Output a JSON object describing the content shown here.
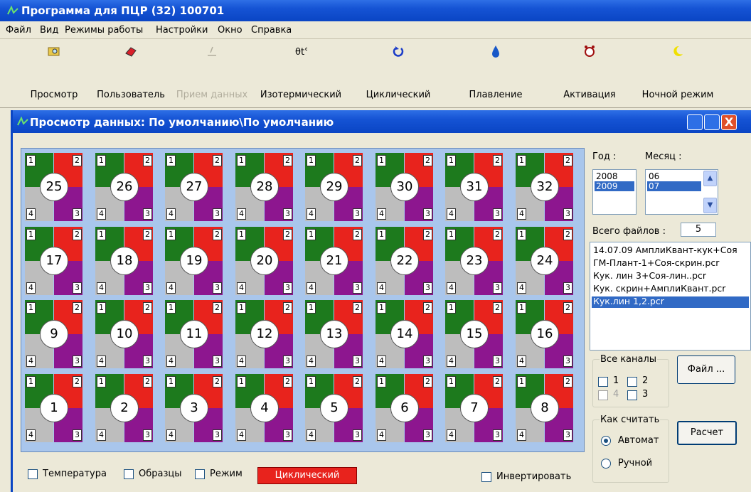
{
  "app": {
    "title": "Программа для ПЦР (32) 100701"
  },
  "menu": [
    "Файл",
    "Вид",
    "Режимы работы",
    "Настройки",
    "Окно",
    "Справка"
  ],
  "toolbar": [
    {
      "label": "Просмотр",
      "icon": "folder-search-icon",
      "enabled": true
    },
    {
      "label": "Пользователь",
      "icon": "eraser-icon",
      "enabled": true
    },
    {
      "label": "Прием данных",
      "icon": "receive-data-icon",
      "enabled": false
    },
    {
      "label": "Изотермический",
      "icon": "thermometer-icon",
      "enabled": true
    },
    {
      "label": "Циклический",
      "icon": "cycle-arrow-icon",
      "enabled": true
    },
    {
      "label": "Плавление",
      "icon": "drop-icon",
      "enabled": true
    },
    {
      "label": "Активация",
      "icon": "alarm-clock-icon",
      "enabled": true
    },
    {
      "label": "Ночной режим",
      "icon": "moon-icon",
      "enabled": true
    }
  ],
  "child": {
    "title": "Просмотр данных: По умолчанию\\По умолчанию",
    "close_glyph": "X"
  },
  "plate": {
    "rows": [
      [
        25,
        26,
        27,
        28,
        29,
        30,
        31,
        32
      ],
      [
        17,
        18,
        19,
        20,
        21,
        22,
        23,
        24
      ],
      [
        9,
        10,
        11,
        12,
        13,
        14,
        15,
        16
      ],
      [
        1,
        2,
        3,
        4,
        5,
        6,
        7,
        8
      ]
    ],
    "corner_labels": {
      "c1": "1",
      "c2": "2",
      "c3": "3",
      "c4": "4"
    },
    "colors": {
      "green": "#1d7a1d",
      "red": "#e8231d",
      "gray": "#bdbdbd",
      "purple": "#8d168f"
    }
  },
  "right": {
    "year_label": "Год :",
    "month_label": "Месяц :",
    "years": [
      "2008",
      "2009"
    ],
    "selected_year": "2009",
    "months": [
      "06",
      "07"
    ],
    "selected_month": "07",
    "files_total_label": "Всего файлов :",
    "files_total": "5",
    "files": [
      "14.07.09 АмплиКвант-кук+Соя",
      "ГМ-Плант-1+Соя-скрин.pcr",
      "Кук. лин 3+Соя-лин..pcr",
      "Кук. скрин+АмплиКвант.pcr",
      "Кук.лин 1,2.pcr"
    ],
    "selected_file": "Кук.лин 1,2.pcr",
    "channels_title": "Все каналы",
    "channels": [
      "1",
      "2",
      "4",
      "3"
    ],
    "file_button": "Файл ...",
    "count_title": "Как считать",
    "count_auto": "Автомат",
    "count_manual": "Ручной",
    "calc_button": "Расчет"
  },
  "bottom": {
    "temperature": "Температура",
    "samples": "Образцы",
    "mode_label": "Режим",
    "mode_value": "Циклический",
    "invert": "Инвертировать"
  }
}
